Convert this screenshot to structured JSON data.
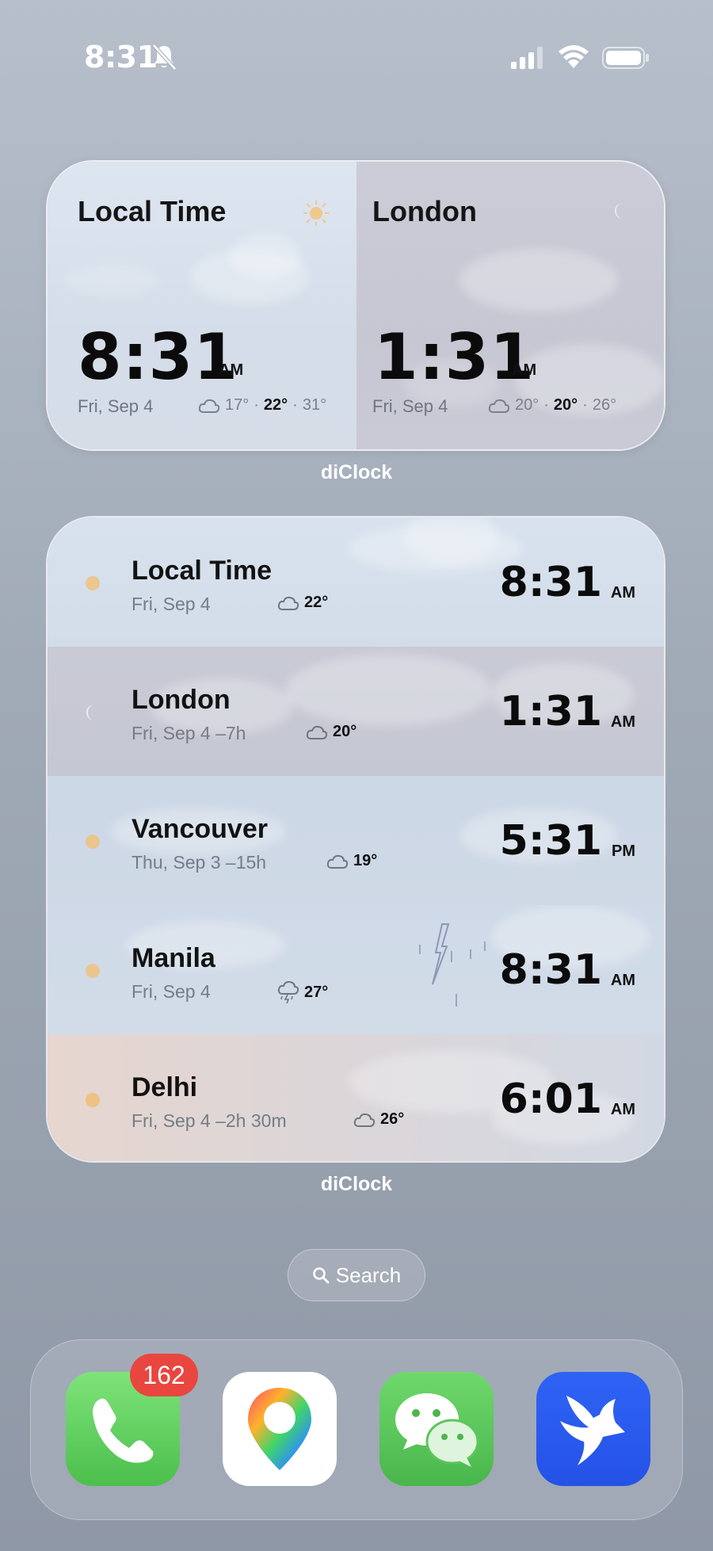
{
  "status_bar": {
    "time": "8:31",
    "icons": [
      "bell-slash-icon",
      "cellular-signal-icon",
      "wifi-icon",
      "battery-icon"
    ]
  },
  "widget_dual": {
    "label": "diClock",
    "local": {
      "title": "Local Time",
      "time": "8:31",
      "ampm": "AM",
      "date": "Fri, Sep 4",
      "low": "17°",
      "current": "22°",
      "high": "31°",
      "icon": "sun-icon"
    },
    "london": {
      "title": "London",
      "time": "1:31",
      "ampm": "AM",
      "date": "Fri, Sep 4",
      "low": "20°",
      "current": "20°",
      "high": "26°",
      "icon": "moon-icon"
    },
    "sep": "·"
  },
  "widget_list": {
    "label": "diClock",
    "rows": [
      {
        "name": "Local Time",
        "date": "Fri, Sep 4",
        "temp": "22°",
        "time": "8:31",
        "ampm": "AM",
        "icon": "sun-icon",
        "weather_icon": "cloud-icon"
      },
      {
        "name": "London",
        "date": "Fri, Sep 4  –7h",
        "temp": "20°",
        "time": "1:31",
        "ampm": "AM",
        "icon": "moon-icon",
        "weather_icon": "cloud-icon"
      },
      {
        "name": "Vancouver",
        "date": "Thu, Sep 3  –15h",
        "temp": "19°",
        "time": "5:31",
        "ampm": "PM",
        "icon": "sun-icon",
        "weather_icon": "cloud-icon"
      },
      {
        "name": "Manila",
        "date": "Fri, Sep 4",
        "temp": "27°",
        "time": "8:31",
        "ampm": "AM",
        "icon": "sun-icon",
        "weather_icon": "thunderstorm-icon"
      },
      {
        "name": "Delhi",
        "date": "Fri, Sep 4  –2h 30m",
        "temp": "26°",
        "time": "6:01",
        "ampm": "AM",
        "icon": "sun-icon",
        "weather_icon": "cloud-icon"
      }
    ]
  },
  "search": {
    "label": "Search"
  },
  "dock": {
    "apps": [
      "Phone",
      "Maps",
      "WeChat",
      "Lark"
    ],
    "phone_badge": "162"
  },
  "colors": {
    "badge": "#e8463f",
    "phone_green": "#5ccf5e",
    "wechat_green": "#57c55a",
    "lark_blue": "#2b5cf0"
  }
}
